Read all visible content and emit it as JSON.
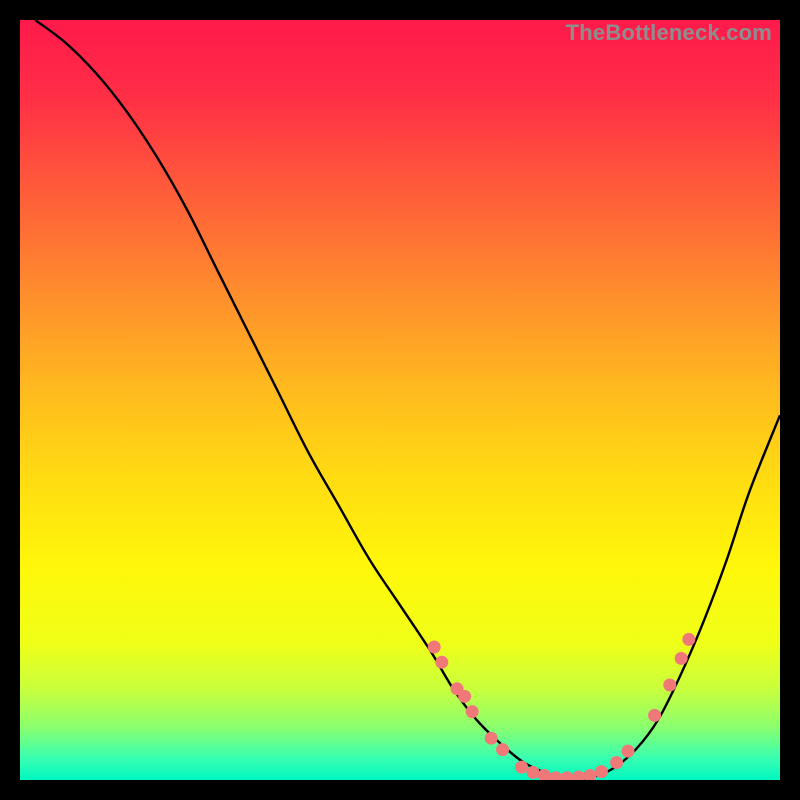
{
  "watermark": "TheBottleneck.com",
  "chart_data": {
    "type": "line",
    "title": "",
    "xlabel": "",
    "ylabel": "",
    "xlim": [
      0,
      100
    ],
    "ylim": [
      0,
      100
    ],
    "grid": false,
    "legend": false,
    "series": [
      {
        "name": "curve",
        "x": [
          2,
          6,
          10,
          14,
          18,
          22,
          26,
          30,
          34,
          38,
          42,
          46,
          50,
          54,
          57,
          60,
          63,
          66,
          69,
          72,
          75,
          78,
          81,
          84,
          87,
          90,
          93,
          96,
          100
        ],
        "y": [
          100,
          97,
          93,
          88,
          82,
          75,
          67,
          59,
          51,
          43,
          36,
          29,
          23,
          17,
          12,
          8,
          5,
          2.5,
          1,
          0.2,
          0.3,
          1.5,
          4,
          8,
          14,
          21,
          29,
          38,
          48
        ]
      }
    ],
    "scatter": {
      "name": "markers",
      "points": [
        {
          "x": 54.5,
          "y": 17.5
        },
        {
          "x": 55.5,
          "y": 15.5
        },
        {
          "x": 57.5,
          "y": 12.0
        },
        {
          "x": 58.5,
          "y": 11.0
        },
        {
          "x": 59.5,
          "y": 9.0
        },
        {
          "x": 62.0,
          "y": 5.5
        },
        {
          "x": 63.5,
          "y": 4.0
        },
        {
          "x": 66.0,
          "y": 1.7
        },
        {
          "x": 67.5,
          "y": 1.0
        },
        {
          "x": 69.0,
          "y": 0.6
        },
        {
          "x": 70.5,
          "y": 0.3
        },
        {
          "x": 72.0,
          "y": 0.3
        },
        {
          "x": 73.5,
          "y": 0.4
        },
        {
          "x": 75.0,
          "y": 0.6
        },
        {
          "x": 76.5,
          "y": 1.1
        },
        {
          "x": 78.5,
          "y": 2.3
        },
        {
          "x": 80.0,
          "y": 3.8
        },
        {
          "x": 83.5,
          "y": 8.5
        },
        {
          "x": 85.5,
          "y": 12.5
        },
        {
          "x": 87.0,
          "y": 16.0
        },
        {
          "x": 88.0,
          "y": 18.5
        }
      ]
    },
    "gradient_stops": [
      {
        "offset": 0.0,
        "color": "#ff1a4b"
      },
      {
        "offset": 0.1,
        "color": "#ff2e46"
      },
      {
        "offset": 0.22,
        "color": "#ff5a3a"
      },
      {
        "offset": 0.35,
        "color": "#ff8a2e"
      },
      {
        "offset": 0.48,
        "color": "#ffb81f"
      },
      {
        "offset": 0.6,
        "color": "#ffdb12"
      },
      {
        "offset": 0.72,
        "color": "#fff70a"
      },
      {
        "offset": 0.82,
        "color": "#efff18"
      },
      {
        "offset": 0.88,
        "color": "#c9ff3c"
      },
      {
        "offset": 0.93,
        "color": "#8bff6e"
      },
      {
        "offset": 0.97,
        "color": "#3bffb0"
      },
      {
        "offset": 1.0,
        "color": "#00f7c0"
      }
    ],
    "marker_color": "#f07878",
    "line_color": "#000000",
    "line_width": 2.4
  }
}
